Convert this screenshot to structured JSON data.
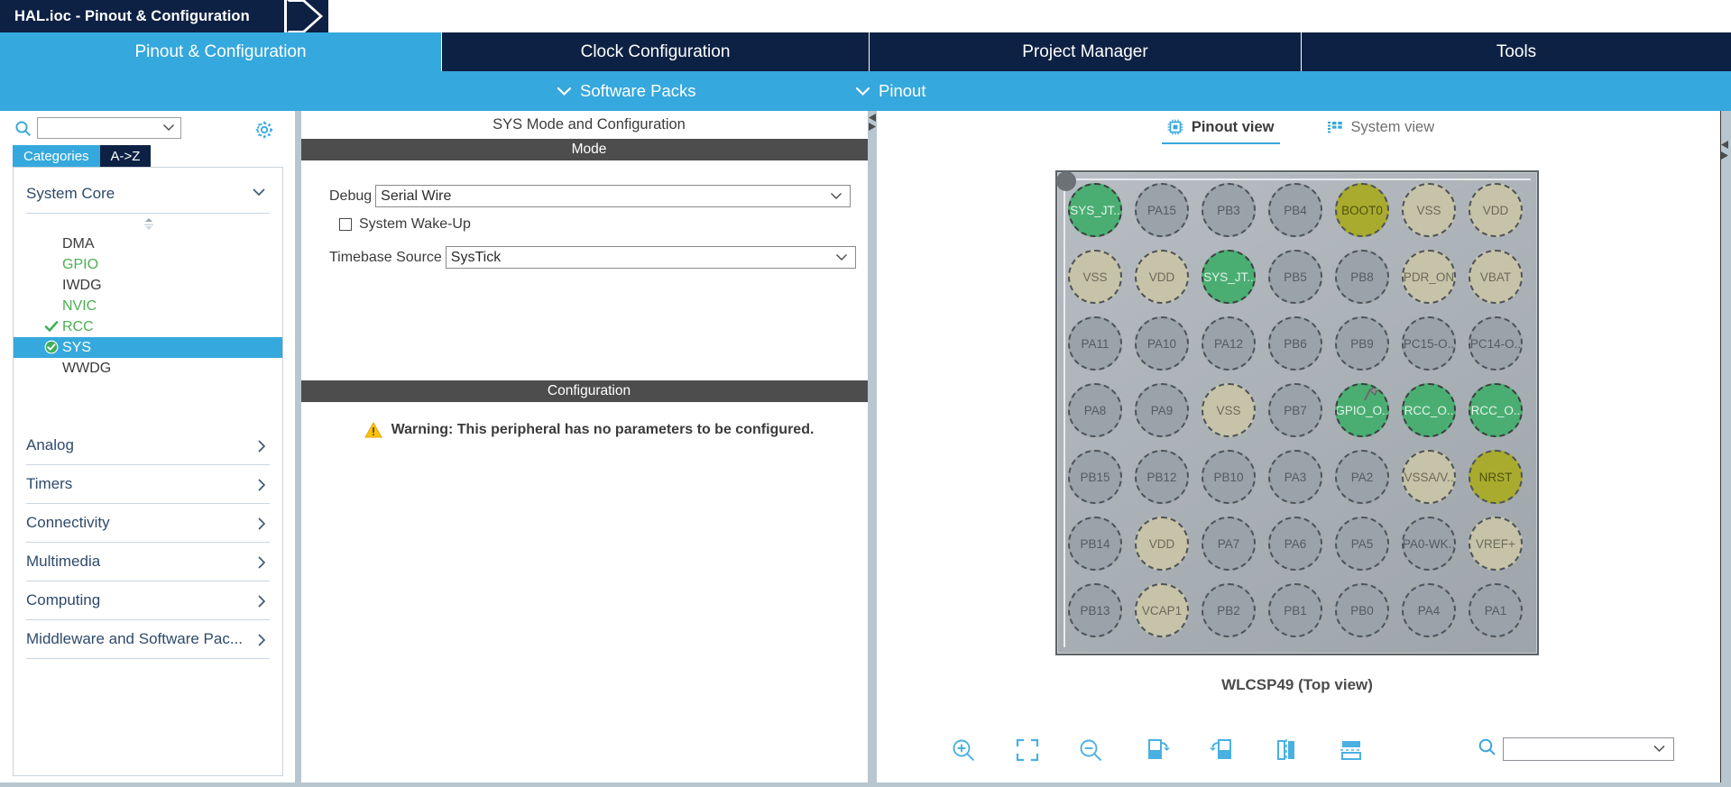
{
  "window": {
    "breadcrumb": "HAL.ioc - Pinout & Configuration"
  },
  "main_tabs": [
    {
      "label": "Pinout & Configuration",
      "active": true
    },
    {
      "label": "Clock Configuration",
      "active": false
    },
    {
      "label": "Project Manager",
      "active": false
    },
    {
      "label": "Tools",
      "active": false
    }
  ],
  "sub_bar": {
    "items": [
      {
        "label": "Software Packs",
        "icon": "chevron-down-icon"
      },
      {
        "label": "Pinout",
        "icon": "chevron-down-icon"
      }
    ]
  },
  "sidebar": {
    "search": {
      "value": "",
      "placeholder": "",
      "icon": "search-icon"
    },
    "settings_icon": "gear-icon",
    "view_tabs": [
      {
        "label": "Categories",
        "active": true
      },
      {
        "label": "A->Z",
        "active": false
      }
    ],
    "groups": [
      {
        "label": "System Core",
        "expanded": true,
        "items": [
          {
            "label": "DMA",
            "state": "none",
            "selected": false
          },
          {
            "label": "GPIO",
            "state": "configured",
            "selected": false
          },
          {
            "label": "IWDG",
            "state": "none",
            "selected": false
          },
          {
            "label": "NVIC",
            "state": "configured",
            "selected": false
          },
          {
            "label": "RCC",
            "state": "checked",
            "selected": false
          },
          {
            "label": "SYS",
            "state": "checked",
            "selected": true
          },
          {
            "label": "WWDG",
            "state": "none",
            "selected": false
          }
        ]
      },
      {
        "label": "Analog",
        "expanded": false,
        "items": []
      },
      {
        "label": "Timers",
        "expanded": false,
        "items": []
      },
      {
        "label": "Connectivity",
        "expanded": false,
        "items": []
      },
      {
        "label": "Multimedia",
        "expanded": false,
        "items": []
      },
      {
        "label": "Computing",
        "expanded": false,
        "items": []
      },
      {
        "label": "Middleware and Software Pac...",
        "expanded": false,
        "items": []
      }
    ]
  },
  "center": {
    "title": "SYS Mode and Configuration",
    "mode_header": "Mode",
    "fields": {
      "debug_label": "Debug",
      "debug_value": "Serial Wire",
      "wakeup_label": "System Wake-Up",
      "wakeup_checked": false,
      "timebase_label": "Timebase Source",
      "timebase_value": "SysTick"
    },
    "config_header": "Configuration",
    "warning_text": "Warning: This peripheral has no parameters to be configured.",
    "warning_icon": "warning-triangle-icon"
  },
  "pinout": {
    "view_tabs": [
      {
        "label": "Pinout view",
        "icon": "chip-icon",
        "active": true
      },
      {
        "label": "System view",
        "icon": "columns-icon",
        "active": false
      }
    ],
    "package_name": "WLCSP49 (Top view)",
    "rows": [
      [
        {
          "label": "SYS_JT..",
          "type": "green"
        },
        {
          "label": "PA15",
          "type": "gray"
        },
        {
          "label": "PB3",
          "type": "gray"
        },
        {
          "label": "PB4",
          "type": "gray"
        },
        {
          "label": "BOOT0",
          "type": "olive"
        },
        {
          "label": "VSS",
          "type": "tan"
        },
        {
          "label": "VDD",
          "type": "tan"
        }
      ],
      [
        {
          "label": "VSS",
          "type": "tan"
        },
        {
          "label": "VDD",
          "type": "tan"
        },
        {
          "label": "SYS_JT..",
          "type": "green"
        },
        {
          "label": "PB5",
          "type": "gray"
        },
        {
          "label": "PB8",
          "type": "gray"
        },
        {
          "label": "PDR_ON",
          "type": "tan"
        },
        {
          "label": "VBAT",
          "type": "tan"
        }
      ],
      [
        {
          "label": "PA11",
          "type": "gray"
        },
        {
          "label": "PA10",
          "type": "gray"
        },
        {
          "label": "PA12",
          "type": "gray"
        },
        {
          "label": "PB6",
          "type": "gray"
        },
        {
          "label": "PB9",
          "type": "gray"
        },
        {
          "label": "PC15-O..",
          "type": "gray"
        },
        {
          "label": "PC14-O..",
          "type": "gray"
        }
      ],
      [
        {
          "label": "PA8",
          "type": "gray"
        },
        {
          "label": "PA9",
          "type": "gray"
        },
        {
          "label": "VSS",
          "type": "tan"
        },
        {
          "label": "PB7",
          "type": "gray"
        },
        {
          "label": "GPIO_O..",
          "type": "green",
          "pinned": true
        },
        {
          "label": "RCC_O..",
          "type": "green"
        },
        {
          "label": "RCC_O..",
          "type": "green"
        }
      ],
      [
        {
          "label": "PB15",
          "type": "gray"
        },
        {
          "label": "PB12",
          "type": "gray"
        },
        {
          "label": "PB10",
          "type": "gray"
        },
        {
          "label": "PA3",
          "type": "gray"
        },
        {
          "label": "PA2",
          "type": "gray"
        },
        {
          "label": "VSSA/V..",
          "type": "tan"
        },
        {
          "label": "NRST",
          "type": "olive"
        }
      ],
      [
        {
          "label": "PB14",
          "type": "gray"
        },
        {
          "label": "VDD",
          "type": "tan"
        },
        {
          "label": "PA7",
          "type": "gray"
        },
        {
          "label": "PA6",
          "type": "gray"
        },
        {
          "label": "PA5",
          "type": "gray"
        },
        {
          "label": "PA0-WK..",
          "type": "gray"
        },
        {
          "label": "VREF+",
          "type": "tan"
        }
      ],
      [
        {
          "label": "PB13",
          "type": "gray"
        },
        {
          "label": "VCAP1",
          "type": "tan"
        },
        {
          "label": "PB2",
          "type": "gray"
        },
        {
          "label": "PB1",
          "type": "gray"
        },
        {
          "label": "PB0",
          "type": "gray"
        },
        {
          "label": "PA4",
          "type": "gray"
        },
        {
          "label": "PA1",
          "type": "gray"
        }
      ]
    ],
    "toolbar": [
      {
        "name": "zoom-in-icon",
        "title": "Zoom in"
      },
      {
        "name": "fit-to-screen-icon",
        "title": "Fit to screen"
      },
      {
        "name": "zoom-out-icon",
        "title": "Zoom out"
      },
      {
        "name": "rotate-right-icon",
        "title": "Rotate right"
      },
      {
        "name": "rotate-left-icon",
        "title": "Rotate left"
      },
      {
        "name": "flip-horizontal-icon",
        "title": "Flip horizontal"
      },
      {
        "name": "flip-vertical-icon",
        "title": "Flip vertical"
      }
    ],
    "search": {
      "value": "",
      "placeholder": "",
      "icon": "search-icon"
    }
  },
  "colors": {
    "brand_blue": "#35a8dd",
    "dark_navy": "#0d2144",
    "pin_green": "#4aae72",
    "pin_olive": "#a8ab2e",
    "pin_tan": "#c6c3a8",
    "pin_gray": "#9aa2aa",
    "warning_yellow": "#ffc20e"
  }
}
